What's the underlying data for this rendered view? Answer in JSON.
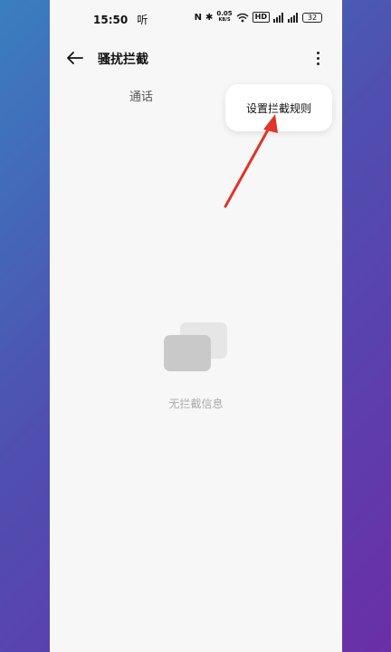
{
  "status_bar": {
    "time": "15:50",
    "extra": "听",
    "speed_value": "0.05",
    "speed_unit": "KB/S",
    "hd_label": "HD",
    "battery": "32"
  },
  "header": {
    "title": "骚扰拦截"
  },
  "tabs": [
    {
      "label": "通话"
    }
  ],
  "popup_menu": {
    "items": [
      {
        "label": "设置拦截规则"
      }
    ]
  },
  "empty_state": {
    "text": "无拦截信息"
  },
  "colors": {
    "annotation_arrow": "#e0352b",
    "background_start": "#3a7fc0",
    "background_end": "#6a2fa6"
  }
}
